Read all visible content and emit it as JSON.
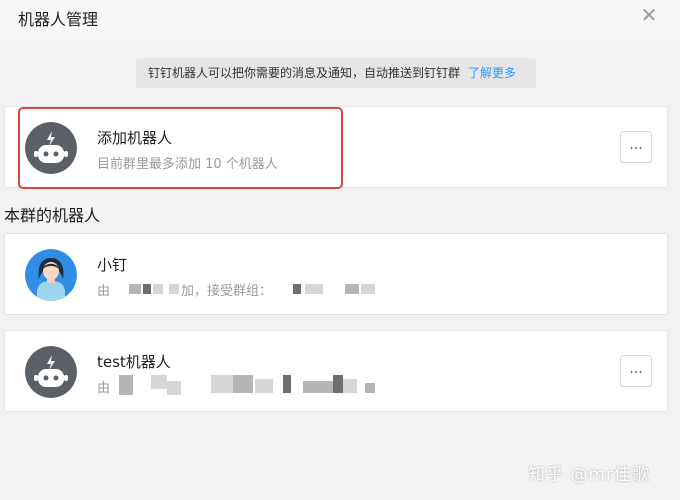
{
  "header": {
    "title": "机器人管理",
    "close_icon": "close-icon"
  },
  "notice": {
    "text": "钉钉机器人可以把你需要的消息及通知，自动推送到钉钉群",
    "link": "了解更多"
  },
  "add_robot": {
    "name": "添加机器人",
    "desc": "目前群里最多添加 10 个机器人",
    "more_label": "..."
  },
  "section": {
    "title": "本群的机器人"
  },
  "robots": [
    {
      "name": "小钉",
      "desc_prefix": "由",
      "desc_mid": "加，接受群组："
    },
    {
      "name": "test机器人",
      "desc_prefix": "由",
      "more_label": "..."
    }
  ],
  "watermark": "知乎 @mr佳歌",
  "colors": {
    "accent_link": "#3296fa",
    "highlight_red": "#d9473a",
    "robot_avatar_bg": "#5b5f66",
    "person_avatar_bg": "#2f8fe6"
  }
}
